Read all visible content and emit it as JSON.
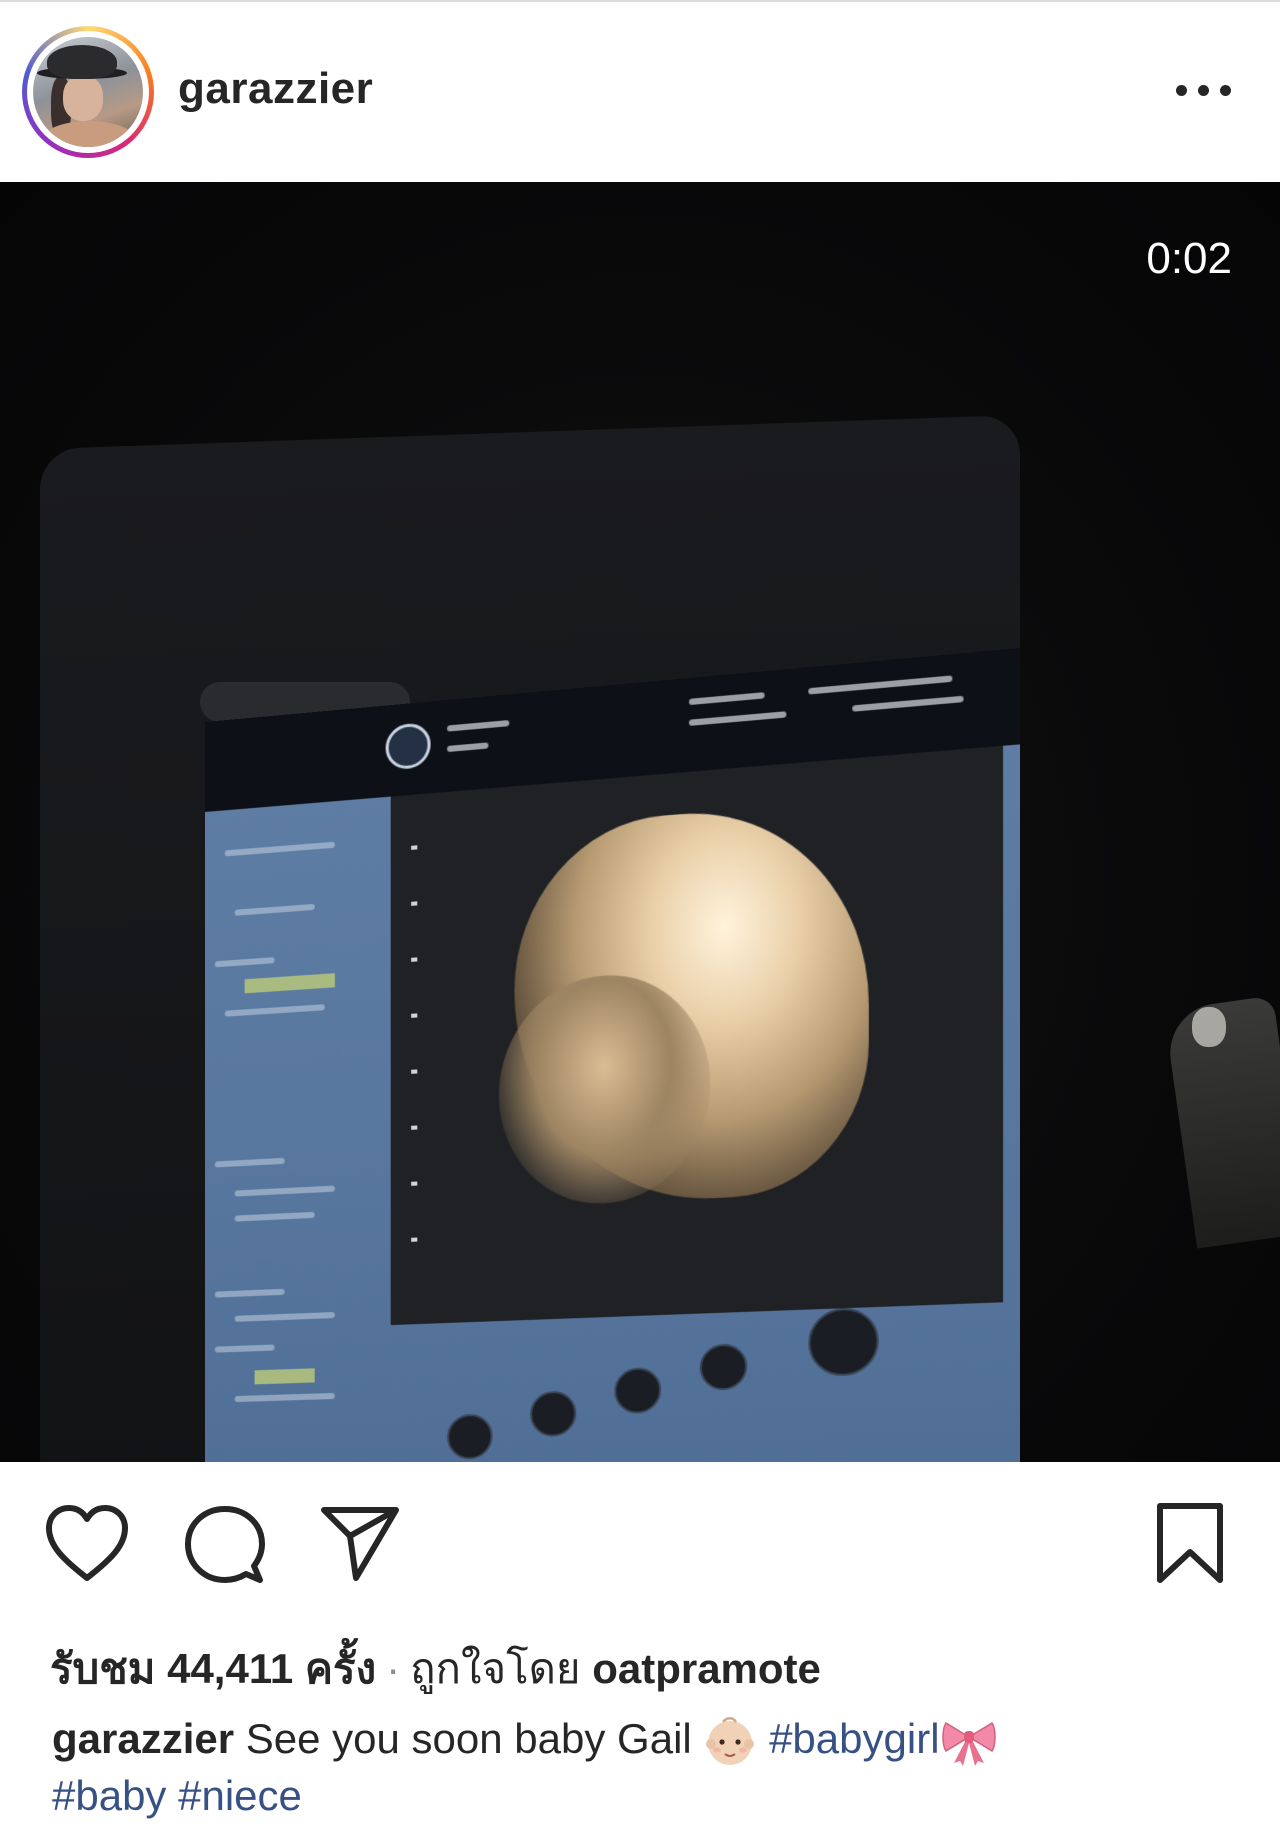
{
  "post": {
    "username": "garazzier",
    "more_icon": "more-horizontal-icon"
  },
  "video": {
    "timer": "0:02"
  },
  "actions": {
    "like_icon": "heart-icon",
    "comment_icon": "comment-icon",
    "share_icon": "send-icon",
    "save_icon": "bookmark-icon"
  },
  "stats": {
    "views_prefix": "รับชม",
    "views_count": "44,411",
    "views_suffix": "ครั้ง",
    "separator": "·",
    "liked_by_label": "ถูกใจโดย",
    "liked_by_user": "oatpramote"
  },
  "caption": {
    "user": "garazzier",
    "text": "See you soon baby Gail",
    "emoji_baby": "baby-emoji",
    "tag1": "#babygirl",
    "emoji_ribbon": "ribbon-emoji",
    "tag2": "#baby",
    "tag3": "#niece"
  },
  "colors": {
    "text": "#262626",
    "hashtag": "#385185",
    "secondary": "#8e8e8e"
  }
}
